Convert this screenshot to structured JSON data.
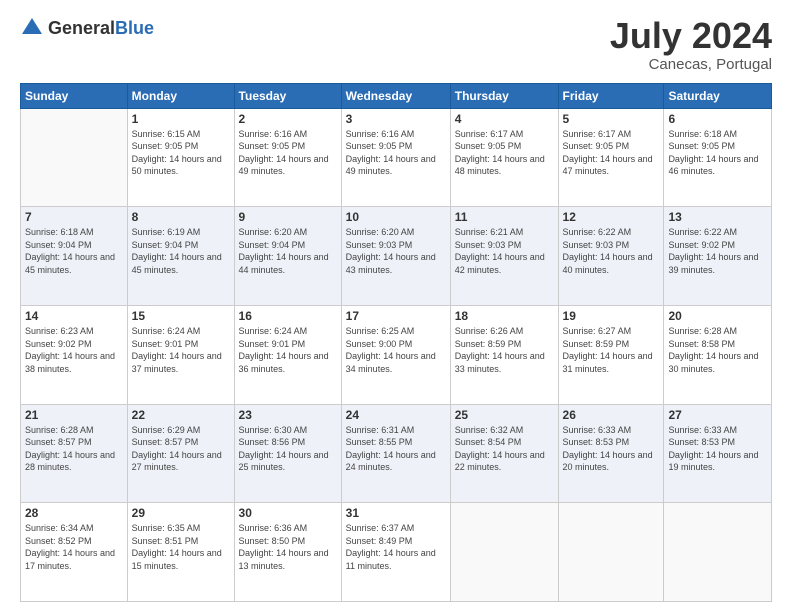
{
  "logo": {
    "general": "General",
    "blue": "Blue"
  },
  "header": {
    "month_year": "July 2024",
    "location": "Canecas, Portugal"
  },
  "weekdays": [
    "Sunday",
    "Monday",
    "Tuesday",
    "Wednesday",
    "Thursday",
    "Friday",
    "Saturday"
  ],
  "rows": [
    [
      {
        "day": "",
        "sunrise": "",
        "sunset": "",
        "daylight": ""
      },
      {
        "day": "1",
        "sunrise": "Sunrise: 6:15 AM",
        "sunset": "Sunset: 9:05 PM",
        "daylight": "Daylight: 14 hours and 50 minutes."
      },
      {
        "day": "2",
        "sunrise": "Sunrise: 6:16 AM",
        "sunset": "Sunset: 9:05 PM",
        "daylight": "Daylight: 14 hours and 49 minutes."
      },
      {
        "day": "3",
        "sunrise": "Sunrise: 6:16 AM",
        "sunset": "Sunset: 9:05 PM",
        "daylight": "Daylight: 14 hours and 49 minutes."
      },
      {
        "day": "4",
        "sunrise": "Sunrise: 6:17 AM",
        "sunset": "Sunset: 9:05 PM",
        "daylight": "Daylight: 14 hours and 48 minutes."
      },
      {
        "day": "5",
        "sunrise": "Sunrise: 6:17 AM",
        "sunset": "Sunset: 9:05 PM",
        "daylight": "Daylight: 14 hours and 47 minutes."
      },
      {
        "day": "6",
        "sunrise": "Sunrise: 6:18 AM",
        "sunset": "Sunset: 9:05 PM",
        "daylight": "Daylight: 14 hours and 46 minutes."
      }
    ],
    [
      {
        "day": "7",
        "sunrise": "Sunrise: 6:18 AM",
        "sunset": "Sunset: 9:04 PM",
        "daylight": "Daylight: 14 hours and 45 minutes."
      },
      {
        "day": "8",
        "sunrise": "Sunrise: 6:19 AM",
        "sunset": "Sunset: 9:04 PM",
        "daylight": "Daylight: 14 hours and 45 minutes."
      },
      {
        "day": "9",
        "sunrise": "Sunrise: 6:20 AM",
        "sunset": "Sunset: 9:04 PM",
        "daylight": "Daylight: 14 hours and 44 minutes."
      },
      {
        "day": "10",
        "sunrise": "Sunrise: 6:20 AM",
        "sunset": "Sunset: 9:03 PM",
        "daylight": "Daylight: 14 hours and 43 minutes."
      },
      {
        "day": "11",
        "sunrise": "Sunrise: 6:21 AM",
        "sunset": "Sunset: 9:03 PM",
        "daylight": "Daylight: 14 hours and 42 minutes."
      },
      {
        "day": "12",
        "sunrise": "Sunrise: 6:22 AM",
        "sunset": "Sunset: 9:03 PM",
        "daylight": "Daylight: 14 hours and 40 minutes."
      },
      {
        "day": "13",
        "sunrise": "Sunrise: 6:22 AM",
        "sunset": "Sunset: 9:02 PM",
        "daylight": "Daylight: 14 hours and 39 minutes."
      }
    ],
    [
      {
        "day": "14",
        "sunrise": "Sunrise: 6:23 AM",
        "sunset": "Sunset: 9:02 PM",
        "daylight": "Daylight: 14 hours and 38 minutes."
      },
      {
        "day": "15",
        "sunrise": "Sunrise: 6:24 AM",
        "sunset": "Sunset: 9:01 PM",
        "daylight": "Daylight: 14 hours and 37 minutes."
      },
      {
        "day": "16",
        "sunrise": "Sunrise: 6:24 AM",
        "sunset": "Sunset: 9:01 PM",
        "daylight": "Daylight: 14 hours and 36 minutes."
      },
      {
        "day": "17",
        "sunrise": "Sunrise: 6:25 AM",
        "sunset": "Sunset: 9:00 PM",
        "daylight": "Daylight: 14 hours and 34 minutes."
      },
      {
        "day": "18",
        "sunrise": "Sunrise: 6:26 AM",
        "sunset": "Sunset: 8:59 PM",
        "daylight": "Daylight: 14 hours and 33 minutes."
      },
      {
        "day": "19",
        "sunrise": "Sunrise: 6:27 AM",
        "sunset": "Sunset: 8:59 PM",
        "daylight": "Daylight: 14 hours and 31 minutes."
      },
      {
        "day": "20",
        "sunrise": "Sunrise: 6:28 AM",
        "sunset": "Sunset: 8:58 PM",
        "daylight": "Daylight: 14 hours and 30 minutes."
      }
    ],
    [
      {
        "day": "21",
        "sunrise": "Sunrise: 6:28 AM",
        "sunset": "Sunset: 8:57 PM",
        "daylight": "Daylight: 14 hours and 28 minutes."
      },
      {
        "day": "22",
        "sunrise": "Sunrise: 6:29 AM",
        "sunset": "Sunset: 8:57 PM",
        "daylight": "Daylight: 14 hours and 27 minutes."
      },
      {
        "day": "23",
        "sunrise": "Sunrise: 6:30 AM",
        "sunset": "Sunset: 8:56 PM",
        "daylight": "Daylight: 14 hours and 25 minutes."
      },
      {
        "day": "24",
        "sunrise": "Sunrise: 6:31 AM",
        "sunset": "Sunset: 8:55 PM",
        "daylight": "Daylight: 14 hours and 24 minutes."
      },
      {
        "day": "25",
        "sunrise": "Sunrise: 6:32 AM",
        "sunset": "Sunset: 8:54 PM",
        "daylight": "Daylight: 14 hours and 22 minutes."
      },
      {
        "day": "26",
        "sunrise": "Sunrise: 6:33 AM",
        "sunset": "Sunset: 8:53 PM",
        "daylight": "Daylight: 14 hours and 20 minutes."
      },
      {
        "day": "27",
        "sunrise": "Sunrise: 6:33 AM",
        "sunset": "Sunset: 8:53 PM",
        "daylight": "Daylight: 14 hours and 19 minutes."
      }
    ],
    [
      {
        "day": "28",
        "sunrise": "Sunrise: 6:34 AM",
        "sunset": "Sunset: 8:52 PM",
        "daylight": "Daylight: 14 hours and 17 minutes."
      },
      {
        "day": "29",
        "sunrise": "Sunrise: 6:35 AM",
        "sunset": "Sunset: 8:51 PM",
        "daylight": "Daylight: 14 hours and 15 minutes."
      },
      {
        "day": "30",
        "sunrise": "Sunrise: 6:36 AM",
        "sunset": "Sunset: 8:50 PM",
        "daylight": "Daylight: 14 hours and 13 minutes."
      },
      {
        "day": "31",
        "sunrise": "Sunrise: 6:37 AM",
        "sunset": "Sunset: 8:49 PM",
        "daylight": "Daylight: 14 hours and 11 minutes."
      },
      {
        "day": "",
        "sunrise": "",
        "sunset": "",
        "daylight": ""
      },
      {
        "day": "",
        "sunrise": "",
        "sunset": "",
        "daylight": ""
      },
      {
        "day": "",
        "sunrise": "",
        "sunset": "",
        "daylight": ""
      }
    ]
  ]
}
